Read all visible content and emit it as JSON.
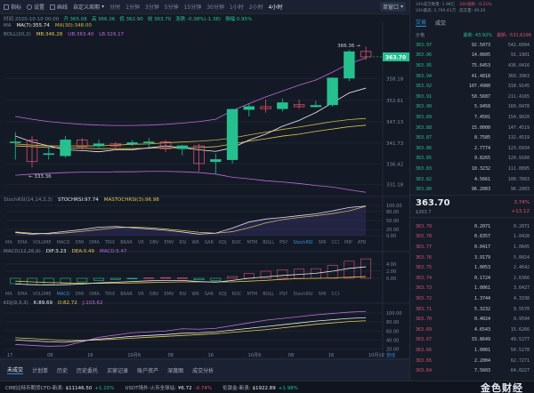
{
  "toolbar": {
    "items": [
      "指标",
      "设置",
      "画线",
      "自定义周期"
    ],
    "intervals": [
      "分时",
      "1分钟",
      "3分钟",
      "5分钟",
      "15分钟",
      "30分钟",
      "1小时",
      "2小时",
      "4小时"
    ],
    "active_interval": "4小时",
    "layout_button": "单窗口"
  },
  "ohlc_line": {
    "time": "时间 2020-10-10 00:00",
    "open": "开 365.08",
    "high": "高 366.36",
    "low": "低 362.90",
    "close": "收 363.70",
    "change": "涨跌 -0.38%(-1.38)",
    "amplitude": "振幅 0.95%"
  },
  "legend": {
    "ma": "MA",
    "ma7": "MA(7):355.74",
    "ma30": "MA(30):348.00",
    "boll": "BOLL(20,2)",
    "mb": "MB:346.28",
    "ub": "UB:363.40",
    "lb": "LB:329.17"
  },
  "price_axis": [
    "358.18",
    "352.61",
    "347.13",
    "341.73",
    "336.42",
    "331.18"
  ],
  "current_price_tag": "363.70",
  "high_marker": "366.36",
  "low_marker": "333.36",
  "stochrsi": {
    "label": "StochRSI(14,14,3,3)",
    "k": "STOCHRSI:97.74",
    "d": "MASTOCHRSI(3):96.98",
    "axis": [
      "100.00",
      "80.00",
      "50.00",
      "20.00",
      "0.00"
    ]
  },
  "macd": {
    "label": "MACD(12,26,9)",
    "dif": "DIF:3.23",
    "dea": "DEA:0.49",
    "macd": "MACD:5.47",
    "axis": [
      "4.00",
      "2.00",
      "0.00"
    ]
  },
  "kdj": {
    "label": "KDJ(9,3,3)",
    "k": "K:89.69",
    "d": "D:82.72",
    "j": "J:103.62",
    "axis": [
      "100.00",
      "80.00",
      "60.00",
      "40.00",
      "20.00"
    ]
  },
  "indicator_tabs": [
    "MA",
    "EMA",
    "VOLUME",
    "MACD",
    "DMI",
    "DMA",
    "TRIX",
    "BRAR",
    "VR",
    "OBV",
    "EMV",
    "RSI",
    "WR",
    "SAR",
    "KDJ",
    "ROC",
    "MTM",
    "BOLL",
    "PSY",
    "StochRSI",
    "SMI",
    "CCI",
    "MIP",
    "ATR"
  ],
  "indicator_tabs_2": [
    "MA",
    "EMA",
    "VOLUME",
    "MACD",
    "DMI",
    "DMA",
    "TRIX",
    "BRAR",
    "VR",
    "OBV",
    "EMV",
    "RSI",
    "WR",
    "SAR",
    "KDJ",
    "ROC",
    "MTM",
    "BOLL",
    "PSY",
    "StochRSI",
    "SMI",
    "CCI"
  ],
  "x_axis": [
    "17",
    "08",
    "16",
    "10月8",
    "08",
    "16",
    "10月9",
    "08",
    "16",
    "10月10"
  ],
  "time_controls": "↻ 10月 切换",
  "auto_label": "自动",
  "bottom_tabs": [
    "未成交",
    "计划单",
    "历史",
    "历史委托",
    "买家记录",
    "账户资产",
    "深度图",
    "成交分析"
  ],
  "chart_data": {
    "type": "candlestick",
    "ylim": [
      329,
      368
    ],
    "candles": [
      {
        "o": 342.0,
        "h": 344.5,
        "l": 337.5,
        "c": 342.0
      },
      {
        "o": 342.5,
        "h": 343.5,
        "l": 335.5,
        "c": 337.0
      },
      {
        "o": 339.0,
        "h": 341.0,
        "l": 337.5,
        "c": 339.0
      },
      {
        "o": 338.5,
        "h": 343.5,
        "l": 338.0,
        "c": 342.5
      },
      {
        "o": 342.5,
        "h": 343.0,
        "l": 340.0,
        "c": 340.8
      },
      {
        "o": 341.0,
        "h": 342.6,
        "l": 340.5,
        "c": 341.5
      },
      {
        "o": 341.5,
        "h": 342.0,
        "l": 339.8,
        "c": 341.0
      },
      {
        "o": 341.5,
        "h": 342.5,
        "l": 341.0,
        "c": 341.8
      },
      {
        "o": 341.8,
        "h": 343.0,
        "l": 340.5,
        "c": 342.0
      },
      {
        "o": 342.0,
        "h": 342.5,
        "l": 339.5,
        "c": 340.3
      },
      {
        "o": 340.3,
        "h": 341.3,
        "l": 338.6,
        "c": 341.0
      },
      {
        "o": 341.0,
        "h": 341.5,
        "l": 334.5,
        "c": 336.5
      },
      {
        "o": 337.0,
        "h": 339.0,
        "l": 334.0,
        "c": 337.5
      },
      {
        "o": 337.5,
        "h": 350.5,
        "l": 336.5,
        "c": 350.3
      },
      {
        "o": 350.3,
        "h": 351.8,
        "l": 348.5,
        "c": 351.0
      },
      {
        "o": 351.0,
        "h": 352.8,
        "l": 349.5,
        "c": 350.5
      },
      {
        "o": 350.5,
        "h": 353.0,
        "l": 349.8,
        "c": 352.0
      },
      {
        "o": 351.5,
        "h": 352.8,
        "l": 350.5,
        "c": 351.0
      },
      {
        "o": 351.0,
        "h": 352.5,
        "l": 350.8,
        "c": 351.3
      },
      {
        "o": 351.5,
        "h": 358.5,
        "l": 351.0,
        "c": 358.3
      },
      {
        "o": 358.3,
        "h": 365.5,
        "l": 357.5,
        "c": 365.0
      },
      {
        "o": 365.08,
        "h": 366.36,
        "l": 362.9,
        "c": 363.7
      }
    ],
    "ma7": [
      343.5,
      342.0,
      341.0,
      340.0,
      339.8,
      339.5,
      340.0,
      340.0,
      340.5,
      341.0,
      340.5,
      340.0,
      339.6,
      340.5,
      342.5,
      344.0,
      346.0,
      347.5,
      349.5,
      352.0,
      354.5,
      355.74
    ],
    "ma30": [
      341.5,
      341.2,
      341.0,
      341.0,
      341.0,
      341.0,
      341.2,
      341.4,
      341.5,
      341.8,
      342.0,
      342.2,
      342.5,
      343.0,
      343.8,
      344.5,
      345.2,
      345.8,
      346.5,
      347.2,
      347.7,
      348.0
    ],
    "mb": [
      341.0,
      340.8,
      340.6,
      340.5,
      340.4,
      340.3,
      340.3,
      340.3,
      340.4,
      340.5,
      340.5,
      340.6,
      340.8,
      341.5,
      342.2,
      342.8,
      343.5,
      344.0,
      344.7,
      345.3,
      345.9,
      346.28
    ],
    "ub": [
      348.5,
      347.8,
      347.2,
      346.8,
      346.5,
      346.3,
      346.2,
      346.2,
      346.3,
      346.5,
      346.8,
      347.2,
      347.8,
      350.0,
      351.8,
      353.5,
      355.0,
      356.5,
      357.8,
      359.8,
      362.0,
      363.4
    ],
    "lb": [
      333.5,
      333.8,
      334.0,
      334.2,
      334.3,
      334.3,
      334.4,
      334.4,
      334.5,
      334.5,
      334.4,
      334.2,
      333.8,
      333.0,
      332.6,
      332.1,
      331.8,
      331.4,
      330.9,
      330.5,
      329.8,
      329.17
    ],
    "stochrsi_k": [
      10,
      5,
      8,
      14,
      20,
      28,
      30,
      26,
      22,
      18,
      12,
      5,
      8,
      25,
      45,
      55,
      60,
      66,
      72,
      82,
      93,
      97.74
    ],
    "stochrsi_d": [
      12,
      8,
      6,
      9,
      14,
      20,
      26,
      28,
      26,
      22,
      17,
      11,
      8,
      13,
      26,
      42,
      53,
      60,
      66,
      73,
      82,
      96.98
    ],
    "macd_hist": [
      -1.5,
      -1.8,
      -1.8,
      -1.4,
      -1.0,
      -0.6,
      -0.3,
      -0.1,
      0.1,
      0.2,
      0.1,
      -0.4,
      -0.6,
      0.5,
      1.4,
      2.0,
      2.4,
      2.6,
      2.7,
      3.6,
      4.8,
      5.47
    ],
    "macd_dif": [
      -1.6,
      -1.8,
      -1.9,
      -1.8,
      -1.6,
      -1.3,
      -1.1,
      -0.9,
      -0.7,
      -0.6,
      -0.6,
      -0.9,
      -1.1,
      -0.6,
      0.0,
      0.4,
      0.8,
      1.1,
      1.4,
      2.0,
      2.8,
      3.23
    ],
    "macd_dea": [
      -0.8,
      -1.0,
      -1.2,
      -1.3,
      -1.4,
      -1.4,
      -1.4,
      -1.3,
      -1.2,
      -1.1,
      -1.0,
      -1.0,
      -1.0,
      -1.0,
      -0.8,
      -0.6,
      -0.3,
      -0.1,
      0.0,
      0.1,
      0.3,
      0.49
    ],
    "kdj_k": [
      40,
      38,
      36,
      35,
      38,
      42,
      45,
      48,
      50,
      52,
      55,
      56,
      58,
      62,
      66,
      70,
      74,
      78,
      82,
      85,
      88,
      89.69
    ],
    "kdj_d": [
      45,
      43,
      41,
      39,
      39,
      40,
      42,
      44,
      46,
      48,
      50,
      52,
      54,
      57,
      60,
      63,
      67,
      71,
      75,
      78,
      81,
      82.72
    ],
    "kdj_j": [
      30,
      28,
      26,
      27,
      36,
      46,
      51,
      56,
      58,
      60,
      65,
      64,
      66,
      72,
      78,
      84,
      88,
      92,
      96,
      99,
      102,
      103.62
    ]
  },
  "right_panel": {
    "title": "24h成交额",
    "stats": [
      "24h成交数量: 1.98亿",
      "24h涨跌: -0.21%",
      "24h最高: 2,799.81万",
      "成交量: 49.20"
    ],
    "tabs": [
      "交易",
      "成交"
    ],
    "headers": [
      "价格",
      "数量",
      "累计"
    ],
    "buy_header": "最新: 43.92%",
    "sell_header": "最新: -531.6196",
    "asks": [
      [
        "363.97",
        "92.5073",
        "542.6094"
      ],
      [
        "363.96",
        "14.0605",
        "91.1901"
      ],
      [
        "363.95",
        "75.6453",
        "436.0416"
      ],
      [
        "363.94",
        "41.4818",
        "360.3963"
      ],
      [
        "363.92",
        "107.4980",
        "318.9145"
      ],
      [
        "363.91",
        "50.5687",
        "211.4165"
      ],
      [
        "363.90",
        "5.9458",
        "160.8478"
      ],
      [
        "363.89",
        "7.4501",
        "154.9020"
      ],
      [
        "363.88",
        "15.0000",
        "147.4519"
      ],
      [
        "363.87",
        "8.7585",
        "132.4519"
      ],
      [
        "363.86",
        "2.7774",
        "123.6934"
      ],
      [
        "363.85",
        "9.8265",
        "120.9160"
      ],
      [
        "363.83",
        "10.3232",
        "111.0895"
      ],
      [
        "363.82",
        "4.5661",
        "100.7663"
      ],
      [
        "363.80",
        "96.2003",
        "96.2003"
      ]
    ],
    "last_price": "363.70",
    "last_sub": "$363.7",
    "change_pct": "3.74%",
    "change_abs": "+13.12",
    "bids": [
      [
        "363.79",
        "0.2071",
        "0.2071"
      ],
      [
        "363.78",
        "0.8357",
        "1.0428"
      ],
      [
        "363.77",
        "0.0417",
        "1.0845"
      ],
      [
        "363.76",
        "3.9179",
        "5.0024"
      ],
      [
        "363.75",
        "1.0053",
        "2.4642"
      ],
      [
        "363.74",
        "0.1724",
        "2.6366"
      ],
      [
        "363.73",
        "1.0061",
        "3.6427"
      ],
      [
        "363.72",
        "1.3744",
        "4.3338"
      ],
      [
        "363.71",
        "5.3232",
        "9.5570"
      ],
      [
        "363.70",
        "0.4024",
        "9.9594"
      ],
      [
        "363.69",
        "4.6543",
        "15.6266"
      ],
      [
        "363.67",
        "33.8649",
        "49.5277"
      ],
      [
        "363.66",
        "1.0001",
        "50.5278"
      ],
      [
        "363.65",
        "2.2004",
        "62.7271"
      ],
      [
        "363.64",
        "7.5603",
        "64.0227"
      ]
    ]
  },
  "tickers": [
    {
      "name": "CME比特币期货CFD-新浪:",
      "price": "$11146.50",
      "chg": "+1.15%"
    },
    {
      "name": "USDT场外-火币全球站:",
      "price": "¥6.72",
      "chg": "-0.74%"
    },
    {
      "name": "伦敦金-新浪:",
      "price": "$1922.89",
      "chg": "+1.98%"
    }
  ],
  "watermark": "金色财经",
  "colors": {
    "up": "#26c08f",
    "down": "#e0506a",
    "ma7": "#f0f0f0",
    "ma30": "#d9b53c",
    "ub": "#c06ad8",
    "lb": "#c06ad8",
    "mb": "#e8c84a",
    "accent": "#2f8fe0"
  }
}
